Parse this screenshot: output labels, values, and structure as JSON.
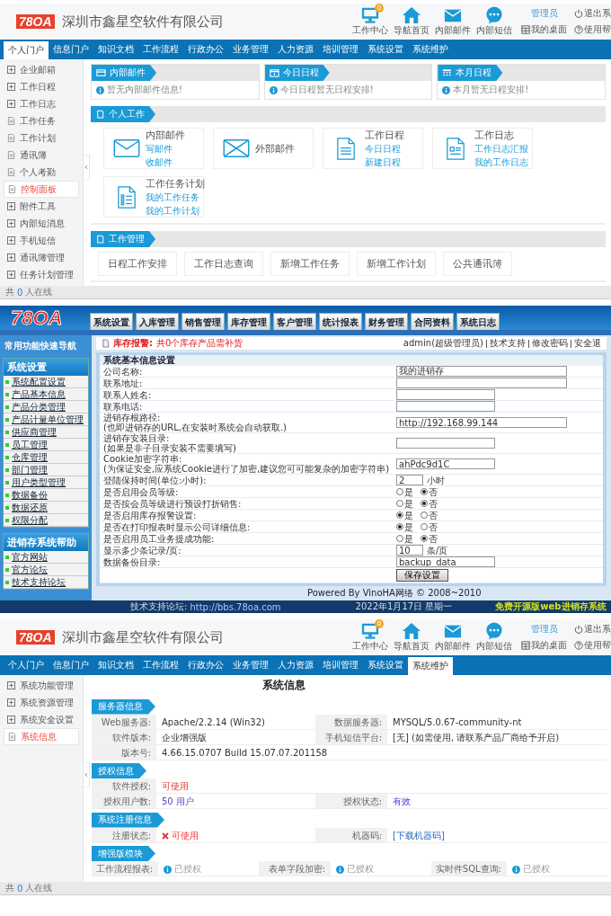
{
  "oa_portal": {
    "header": {
      "logo": "78OA",
      "company": "深圳市鑫星空软件有限公司",
      "icons": [
        {
          "kind": "monitor",
          "label": "工作中心",
          "badge": "0"
        },
        {
          "kind": "home",
          "label": "导航首页"
        },
        {
          "kind": "mail",
          "label": "内部邮件"
        },
        {
          "kind": "chat",
          "label": "内部短信"
        }
      ],
      "user_links": [
        {
          "kind": "user",
          "label": "管理员"
        },
        {
          "kind": "power",
          "label": "退出系"
        },
        {
          "kind": "desk",
          "label": "我的桌面"
        },
        {
          "kind": "help",
          "label": "使用帮"
        }
      ]
    },
    "nav": [
      {
        "label": "个人门户",
        "selected": true
      },
      {
        "label": "信息门户",
        "selected": false
      },
      {
        "label": "知识文档",
        "selected": false
      },
      {
        "label": "工作流程",
        "selected": false
      },
      {
        "label": "行政办公",
        "selected": false
      },
      {
        "label": "业务管理",
        "selected": false
      },
      {
        "label": "人力资源",
        "selected": false
      },
      {
        "label": "培训管理",
        "selected": false
      },
      {
        "label": "系统设置",
        "selected": false
      },
      {
        "label": "系统维护",
        "selected": false
      }
    ],
    "sidebar": [
      {
        "kind": "folder",
        "label": "企业邮箱",
        "selected": false
      },
      {
        "kind": "folder",
        "label": "工作日程",
        "selected": false
      },
      {
        "kind": "folder",
        "label": "工作日志",
        "selected": false
      },
      {
        "kind": "page",
        "label": "工作任务",
        "selected": false
      },
      {
        "kind": "page",
        "label": "工作计划",
        "selected": false
      },
      {
        "kind": "page",
        "label": "通讯簿",
        "selected": false
      },
      {
        "kind": "page",
        "label": "个人考勤",
        "selected": false
      },
      {
        "kind": "page",
        "label": "控制面板",
        "selected": true
      },
      {
        "kind": "folder",
        "label": "附件工具",
        "selected": false
      },
      {
        "kind": "folder",
        "label": "内部短消息",
        "selected": false
      },
      {
        "kind": "folder",
        "label": "手机短信",
        "selected": false
      },
      {
        "kind": "folder",
        "label": "通讯簿管理",
        "selected": false
      },
      {
        "kind": "folder",
        "label": "任务计划管理",
        "selected": false
      }
    ],
    "widgets": [
      {
        "kind": "mail",
        "title": "内部邮件",
        "message": "暂无内部邮件信息!"
      },
      {
        "kind": "day",
        "title": "今日日程",
        "message": "今日日程暂无日程安排!"
      },
      {
        "kind": "month",
        "title": "本月日程",
        "message": "本月暂无日程安排!"
      }
    ],
    "personal_work": {
      "title": "个人工作",
      "cards": [
        {
          "kind": "mail",
          "title": "内部邮件",
          "links": [
            "写邮件",
            "收邮件"
          ]
        },
        {
          "kind": "mail_x",
          "title": "外部邮件"
        },
        {
          "kind": "doc",
          "title": "工作日程",
          "links": [
            "今日日程",
            "新建日程"
          ]
        },
        {
          "kind": "form",
          "title": "工作日志",
          "links": [
            "工作日志汇报",
            "我的工作日志"
          ]
        },
        {
          "kind": "list",
          "title": "工作任务计划",
          "links": [
            "我的工作任务",
            "我的工作计划"
          ]
        }
      ]
    },
    "work_management": {
      "title": "工作管理",
      "buttons": [
        "日程工作安排",
        "工作日志查询",
        "新增工作任务",
        "新增工作计划",
        "公共通讯簿"
      ]
    },
    "status_bar": {
      "prefix": "共",
      "count": "0",
      "suffix": "人在线"
    }
  },
  "jxc_settings": {
    "logo": "78OA",
    "tabs": [
      "系统设置",
      "入库管理",
      "销售管理",
      "库存管理",
      "客户管理",
      "统计报表",
      "财务管理",
      "合同资料",
      "系统日志"
    ],
    "sidebar_title": "常用功能快速导航",
    "groups": [
      {
        "title": "系统设置",
        "items": [
          "系统配置设置",
          "产品基本信息",
          "产品分类管理",
          "产品计量单位管理",
          "供应商管理",
          "员工管理",
          "仓库管理",
          "部门管理",
          "用户类型管理",
          "数据备份",
          "数据还原",
          "权限分配"
        ]
      },
      {
        "title": "进销存系统帮助",
        "items": [
          "官方网站",
          "官方论坛",
          "技术支持论坛"
        ]
      }
    ],
    "notice": {
      "label": "库存报警:",
      "text": "共0个库存产品需补货"
    },
    "user_bar": [
      "admin(超级管理员)",
      "技术支持",
      "修改密码",
      "安全退"
    ],
    "form": {
      "title": "系统基本信息设置",
      "rows": [
        {
          "kind": "long_text",
          "label": "公司名称:",
          "value": "我的进销存"
        },
        {
          "kind": "long_text",
          "label": "联系地址:"
        },
        {
          "kind": "short_text",
          "label": "联系人姓名:"
        },
        {
          "kind": "short_text",
          "label": "联系电话:"
        },
        {
          "kind": "long_text",
          "label": "进销存根路径:",
          "note": "(也即进销存的URL,在安装时系统会自动获取.)",
          "value": "http://192.168.99.144"
        },
        {
          "kind": "short_text",
          "label": "进销存安装目录:",
          "note": "(如果是非子目录安装不需要填写)"
        },
        {
          "kind": "short_text",
          "label": "Cookie加密字符串:",
          "note": "(为保证安全,应系统Cookie进行了加密,建议您可可能复杂的加密字符串)",
          "value": "ahPdc9d1C"
        },
        {
          "kind": "number_unit",
          "label": "登陆保持时间(单位:小时):",
          "value": "2",
          "unit": "小时"
        },
        {
          "kind": "radio",
          "label": "是否启用会员等级:",
          "options": [
            {
              "label": "是",
              "selected": false
            },
            {
              "label": "否",
              "selected": true
            }
          ]
        },
        {
          "kind": "radio",
          "label": "是否按会员等级进行预设打折销售:",
          "options": [
            {
              "label": "是",
              "selected": false
            },
            {
              "label": "否",
              "selected": true
            }
          ]
        },
        {
          "kind": "radio",
          "label": "是否启用库存报警设置:",
          "options": [
            {
              "label": "是",
              "selected": true
            },
            {
              "label": "否",
              "selected": false
            }
          ]
        },
        {
          "kind": "radio",
          "label": "是否在打印报表时显示公司详细信息:",
          "options": [
            {
              "label": "是",
              "selected": true
            },
            {
              "label": "否",
              "selected": false
            }
          ]
        },
        {
          "kind": "radio",
          "label": "是否启用员工业务提成功能:",
          "options": [
            {
              "label": "是",
              "selected": false
            },
            {
              "label": "否",
              "selected": true
            }
          ]
        },
        {
          "kind": "number_unit",
          "label": "显示多少条记录/页:",
          "value": "10",
          "unit": "条/页"
        },
        {
          "kind": "short_text",
          "label": "数据备份目录:",
          "value": "backup_data"
        }
      ],
      "save_button": "保存设置"
    },
    "powered_by": "Powered By VinoHA网络 © 2008~2010",
    "bottom_bar": {
      "forum_label": "技术支持论坛:",
      "forum_url": "http://bbs.78oa.com",
      "date": "2022年1月17日 星期一",
      "slogan": "免费开源版web进销存系统"
    }
  },
  "oa_system_info": {
    "header": {
      "logo": "78OA",
      "company": "深圳市鑫星空软件有限公司",
      "icons": [
        {
          "kind": "monitor",
          "label": "工作中心",
          "badge": "0"
        },
        {
          "kind": "home",
          "label": "导航首页"
        },
        {
          "kind": "mail",
          "label": "内部邮件"
        },
        {
          "kind": "chat",
          "label": "内部短信"
        }
      ],
      "user_links": [
        {
          "kind": "user",
          "label": "管理员"
        },
        {
          "kind": "power",
          "label": "退出系"
        },
        {
          "kind": "desk",
          "label": "我的桌面"
        },
        {
          "kind": "help",
          "label": "使用帮"
        }
      ]
    },
    "nav": [
      {
        "label": "个人门户",
        "selected": false
      },
      {
        "label": "信息门户",
        "selected": false
      },
      {
        "label": "知识文档",
        "selected": false
      },
      {
        "label": "工作流程",
        "selected": false
      },
      {
        "label": "行政办公",
        "selected": false
      },
      {
        "label": "业务管理",
        "selected": false
      },
      {
        "label": "人力资源",
        "selected": false
      },
      {
        "label": "培训管理",
        "selected": false
      },
      {
        "label": "系统设置",
        "selected": false
      },
      {
        "label": "系统维护",
        "selected": true
      }
    ],
    "sidebar": [
      {
        "kind": "folder",
        "label": "系统功能管理",
        "selected": false
      },
      {
        "kind": "folder",
        "label": "系统资源管理",
        "selected": false
      },
      {
        "kind": "folder",
        "label": "系统安全设置",
        "selected": false
      },
      {
        "kind": "page",
        "label": "系统信息",
        "selected": true
      }
    ],
    "title": "系统信息",
    "sections": [
      {
        "title": "服务器信息",
        "rows": [
          [
            {
              "label": "Web服务器:",
              "value": "Apache/2.2.14 (Win32)",
              "kind": "plain"
            },
            {
              "label": "数据服务器:",
              "value": "MYSQL/5.0.67-community-nt",
              "kind": "plain"
            }
          ],
          [
            {
              "label": "软件版本:",
              "value": "企业增强版",
              "kind": "plain"
            },
            {
              "label": "手机短信平台:",
              "value": "[无] (如需使用, 请联系产品厂商给予开启)",
              "kind": "plain"
            }
          ],
          [
            {
              "label": "版本号:",
              "value": "4.66.15.0707 Build 15.07.07.201158",
              "kind": "plain"
            }
          ]
        ]
      },
      {
        "title": "授权信息",
        "rows": [
          [
            {
              "label": "软件授权:",
              "value": "可使用",
              "kind": "alert"
            }
          ],
          [
            {
              "label": "授权用户数:",
              "value": "50 用户",
              "kind": "count"
            },
            {
              "label": "授权状态:",
              "value": "有效",
              "kind": "count"
            }
          ]
        ]
      },
      {
        "title": "系统注册信息",
        "rows": [
          [
            {
              "label": "注册状态:",
              "value": "可使用",
              "kind": "cross_alert"
            },
            {
              "label": "机器码:",
              "value": "[下载机器码]",
              "kind": "link"
            }
          ]
        ]
      },
      {
        "title": "增强版模块",
        "rows": [
          [
            {
              "label": "工作流程报表:",
              "value": "已授权",
              "kind": "granted"
            },
            {
              "label": "表单字段加密:",
              "value": "已授权",
              "kind": "granted"
            },
            {
              "label": "实时件SQL查询:",
              "value": "已授权",
              "kind": "granted"
            }
          ]
        ]
      }
    ],
    "status_bar": {
      "prefix": "共",
      "count": "0",
      "suffix": "人在线"
    }
  }
}
